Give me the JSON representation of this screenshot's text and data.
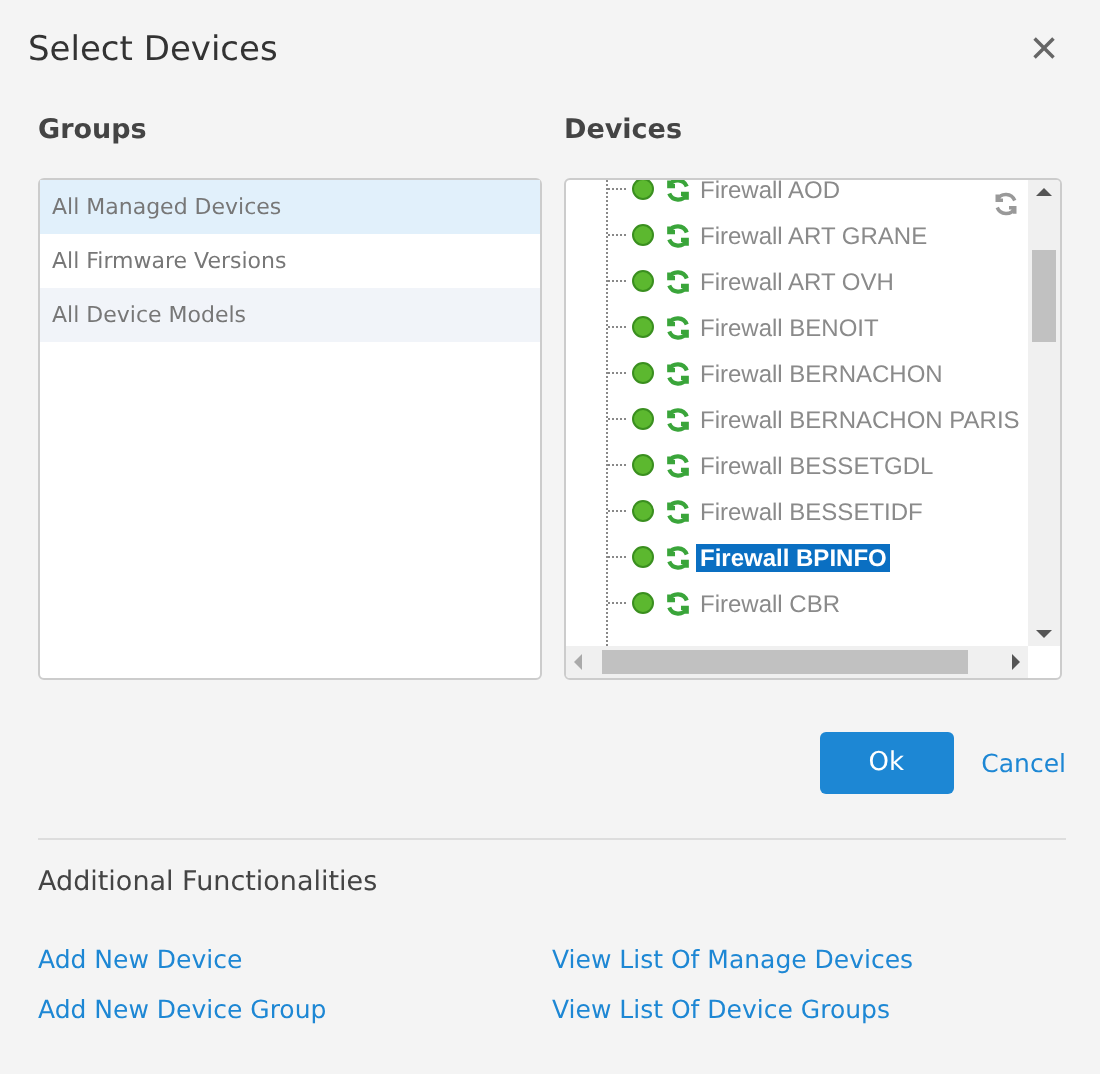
{
  "window": {
    "title": "Select Devices",
    "close": "×"
  },
  "groups": {
    "heading": "Groups",
    "items": [
      {
        "label": "All Managed Devices",
        "selected": true
      },
      {
        "label": "All Firmware Versions",
        "selected": false
      },
      {
        "label": "All Device Models",
        "selected": false
      }
    ]
  },
  "devices": {
    "heading": "Devices",
    "items": [
      {
        "label": "Firewall AOD",
        "selected": false
      },
      {
        "label": "Firewall ART GRANE",
        "selected": false
      },
      {
        "label": "Firewall ART OVH",
        "selected": false
      },
      {
        "label": "Firewall BENOIT",
        "selected": false
      },
      {
        "label": "Firewall BERNACHON",
        "selected": false
      },
      {
        "label": "Firewall BERNACHON PARIS",
        "selected": false
      },
      {
        "label": "Firewall BESSETGDL",
        "selected": false
      },
      {
        "label": "Firewall BESSETIDF",
        "selected": false
      },
      {
        "label": "Firewall BPINFO",
        "selected": true
      },
      {
        "label": "Firewall CBR",
        "selected": false
      }
    ]
  },
  "buttons": [
    {
      "label": "Ok",
      "kind": "primary"
    },
    {
      "label": "Cancel",
      "kind": "link"
    }
  ],
  "additional": {
    "heading": "Additional Functionalities",
    "links": [
      "Add New Device",
      "View List Of Manage Devices",
      "Add New Device Group",
      "View List Of Device Groups"
    ]
  }
}
